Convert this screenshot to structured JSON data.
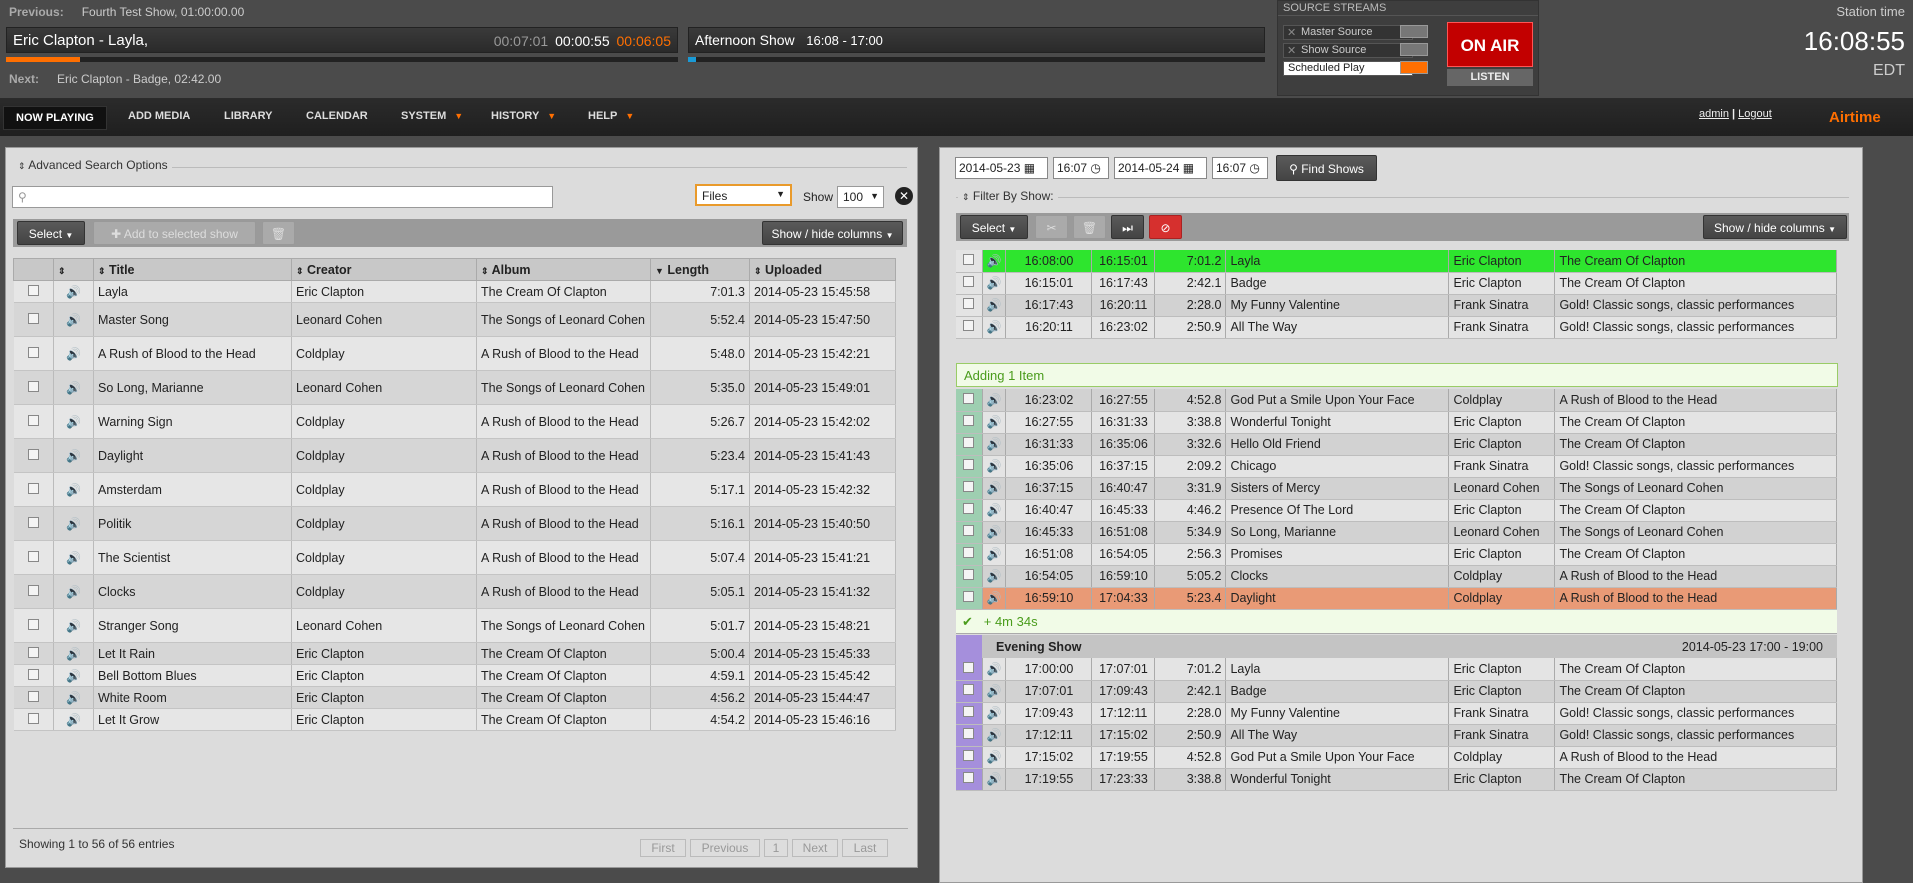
{
  "header": {
    "previous_label": "Previous:",
    "previous_value": "Fourth Test Show, 01:00:00.00",
    "current_track": "Eric Clapton - Layla,",
    "elapsed": "00:07:01",
    "remaining": "00:00:55",
    "time_left": "00:06:05",
    "next_label": "Next:",
    "next_value": "Eric Clapton - Badge, 02:42.00",
    "current_show": "Afternoon Show",
    "current_show_time": "16:08 - 17:00",
    "track_progress": 0.11,
    "show_progress": 0.014
  },
  "streams": {
    "title": "SOURCE STREAMS",
    "master": "Master Source",
    "show": "Show Source",
    "scheduled": "Scheduled Play",
    "on_air": "ON AIR",
    "listen": "LISTEN"
  },
  "station": {
    "label": "Station time",
    "time": "16:08:55",
    "zone": "EDT"
  },
  "nav": {
    "now_playing": "NOW PLAYING",
    "add_media": "ADD MEDIA",
    "library": "LIBRARY",
    "calendar": "CALENDAR",
    "system": "SYSTEM",
    "history": "HISTORY",
    "help": "HELP",
    "admin": "admin",
    "sep": "|",
    "logout": "Logout",
    "logo": "Airtime"
  },
  "library": {
    "advanced": "Advanced Search Options",
    "search_placeholder": "",
    "type_select": "Files",
    "show_label": "Show",
    "show_count": "100",
    "select_btn": "Select",
    "add_btn": "Add to selected show",
    "columns_btn": "Show / hide columns",
    "headers": {
      "title": "Title",
      "creator": "Creator",
      "album": "Album",
      "length": "Length",
      "uploaded": "Uploaded"
    },
    "rows": [
      {
        "t": "Layla",
        "c": "Eric Clapton",
        "a": "The Cream Of Clapton",
        "l": "7:01.3",
        "u": "2014-05-23 15:45:58"
      },
      {
        "t": "Master Song",
        "c": "Leonard Cohen",
        "a": "The Songs of Leonard Cohen",
        "l": "5:52.4",
        "u": "2014-05-23 15:47:50"
      },
      {
        "t": "A Rush of Blood to the Head",
        "c": "Coldplay",
        "a": "A Rush of Blood to the Head",
        "l": "5:48.0",
        "u": "2014-05-23 15:42:21"
      },
      {
        "t": "So Long, Marianne",
        "c": "Leonard Cohen",
        "a": "The Songs of Leonard Cohen",
        "l": "5:35.0",
        "u": "2014-05-23 15:49:01"
      },
      {
        "t": "Warning Sign",
        "c": "Coldplay",
        "a": "A Rush of Blood to the Head",
        "l": "5:26.7",
        "u": "2014-05-23 15:42:02"
      },
      {
        "t": "Daylight",
        "c": "Coldplay",
        "a": "A Rush of Blood to the Head",
        "l": "5:23.4",
        "u": "2014-05-23 15:41:43"
      },
      {
        "t": "Amsterdam",
        "c": "Coldplay",
        "a": "A Rush of Blood to the Head",
        "l": "5:17.1",
        "u": "2014-05-23 15:42:32"
      },
      {
        "t": "Politik",
        "c": "Coldplay",
        "a": "A Rush of Blood to the Head",
        "l": "5:16.1",
        "u": "2014-05-23 15:40:50"
      },
      {
        "t": "The Scientist",
        "c": "Coldplay",
        "a": "A Rush of Blood to the Head",
        "l": "5:07.4",
        "u": "2014-05-23 15:41:21"
      },
      {
        "t": "Clocks",
        "c": "Coldplay",
        "a": "A Rush of Blood to the Head",
        "l": "5:05.1",
        "u": "2014-05-23 15:41:32"
      },
      {
        "t": "Stranger Song",
        "c": "Leonard Cohen",
        "a": "The Songs of Leonard Cohen",
        "l": "5:01.7",
        "u": "2014-05-23 15:48:21"
      },
      {
        "t": "Let It Rain",
        "c": "Eric Clapton",
        "a": "The Cream Of Clapton",
        "l": "5:00.4",
        "u": "2014-05-23 15:45:33"
      },
      {
        "t": "Bell Bottom Blues",
        "c": "Eric Clapton",
        "a": "The Cream Of Clapton",
        "l": "4:59.1",
        "u": "2014-05-23 15:45:42"
      },
      {
        "t": "White Room",
        "c": "Eric Clapton",
        "a": "The Cream Of Clapton",
        "l": "4:56.2",
        "u": "2014-05-23 15:44:47"
      },
      {
        "t": "Let It Grow",
        "c": "Eric Clapton",
        "a": "The Cream Of Clapton",
        "l": "4:54.2",
        "u": "2014-05-23 15:46:16"
      }
    ],
    "footer": "Showing 1 to 56 of 56 entries",
    "pager": {
      "first": "First",
      "previous": "Previous",
      "page": "1",
      "next": "Next",
      "last": "Last"
    }
  },
  "schedule": {
    "start_date": "2014-05-23",
    "start_time": "16:07",
    "end_date": "2014-05-24",
    "end_time": "16:07",
    "find_btn": "Find Shows",
    "filter_label": "Filter By Show:",
    "select_btn": "Select",
    "columns_btn": "Show / hide columns",
    "notice": "Adding 1 Item",
    "rows_a": [
      {
        "s": "16:08:00",
        "e": "16:15:01",
        "l": "7:01.2",
        "t": "Layla",
        "c": "Eric Clapton",
        "a": "The Cream Of Clapton"
      },
      {
        "s": "16:15:01",
        "e": "16:17:43",
        "l": "2:42.1",
        "t": "Badge",
        "c": "Eric Clapton",
        "a": "The Cream Of Clapton"
      },
      {
        "s": "16:17:43",
        "e": "16:20:11",
        "l": "2:28.0",
        "t": "My Funny Valentine",
        "c": "Frank Sinatra",
        "a": "Gold! Classic songs, classic performances"
      },
      {
        "s": "16:20:11",
        "e": "16:23:02",
        "l": "2:50.9",
        "t": "All The Way",
        "c": "Frank Sinatra",
        "a": "Gold! Classic songs, classic performances"
      }
    ],
    "rows_b": [
      {
        "s": "16:23:02",
        "e": "16:27:55",
        "l": "4:52.8",
        "t": "God Put a Smile Upon Your Face",
        "c": "Coldplay",
        "a": "A Rush of Blood to the Head"
      },
      {
        "s": "16:27:55",
        "e": "16:31:33",
        "l": "3:38.8",
        "t": "Wonderful Tonight",
        "c": "Eric Clapton",
        "a": "The Cream Of Clapton"
      },
      {
        "s": "16:31:33",
        "e": "16:35:06",
        "l": "3:32.6",
        "t": "Hello Old Friend",
        "c": "Eric Clapton",
        "a": "The Cream Of Clapton"
      },
      {
        "s": "16:35:06",
        "e": "16:37:15",
        "l": "2:09.2",
        "t": "Chicago",
        "c": "Frank Sinatra",
        "a": "Gold! Classic songs, classic performances"
      },
      {
        "s": "16:37:15",
        "e": "16:40:47",
        "l": "3:31.9",
        "t": "Sisters of Mercy",
        "c": "Leonard Cohen",
        "a": "The Songs of Leonard Cohen"
      },
      {
        "s": "16:40:47",
        "e": "16:45:33",
        "l": "4:46.2",
        "t": "Presence Of The Lord",
        "c": "Eric Clapton",
        "a": "The Cream Of Clapton"
      },
      {
        "s": "16:45:33",
        "e": "16:51:08",
        "l": "5:34.9",
        "t": "So Long, Marianne",
        "c": "Leonard Cohen",
        "a": "The Songs of Leonard Cohen"
      },
      {
        "s": "16:51:08",
        "e": "16:54:05",
        "l": "2:56.3",
        "t": "Promises",
        "c": "Eric Clapton",
        "a": "The Cream Of Clapton"
      },
      {
        "s": "16:54:05",
        "e": "16:59:10",
        "l": "5:05.2",
        "t": "Clocks",
        "c": "Coldplay",
        "a": "A Rush of Blood to the Head"
      },
      {
        "s": "16:59:10",
        "e": "17:04:33",
        "l": "5:23.4",
        "t": "Daylight",
        "c": "Coldplay",
        "a": "A Rush of Blood to the Head"
      }
    ],
    "overflow": "+ 4m 34s",
    "show2_name": "Evening Show",
    "show2_time": "2014-05-23 17:00 - 19:00",
    "rows_c": [
      {
        "s": "17:00:00",
        "e": "17:07:01",
        "l": "7:01.2",
        "t": "Layla",
        "c": "Eric Clapton",
        "a": "The Cream Of Clapton"
      },
      {
        "s": "17:07:01",
        "e": "17:09:43",
        "l": "2:42.1",
        "t": "Badge",
        "c": "Eric Clapton",
        "a": "The Cream Of Clapton"
      },
      {
        "s": "17:09:43",
        "e": "17:12:11",
        "l": "2:28.0",
        "t": "My Funny Valentine",
        "c": "Frank Sinatra",
        "a": "Gold! Classic songs, classic performances"
      },
      {
        "s": "17:12:11",
        "e": "17:15:02",
        "l": "2:50.9",
        "t": "All The Way",
        "c": "Frank Sinatra",
        "a": "Gold! Classic songs, classic performances"
      },
      {
        "s": "17:15:02",
        "e": "17:19:55",
        "l": "4:52.8",
        "t": "God Put a Smile Upon Your Face",
        "c": "Coldplay",
        "a": "A Rush of Blood to the Head"
      },
      {
        "s": "17:19:55",
        "e": "17:23:33",
        "l": "3:38.8",
        "t": "Wonderful Tonight",
        "c": "Eric Clapton",
        "a": "The Cream Of Clapton"
      }
    ]
  }
}
